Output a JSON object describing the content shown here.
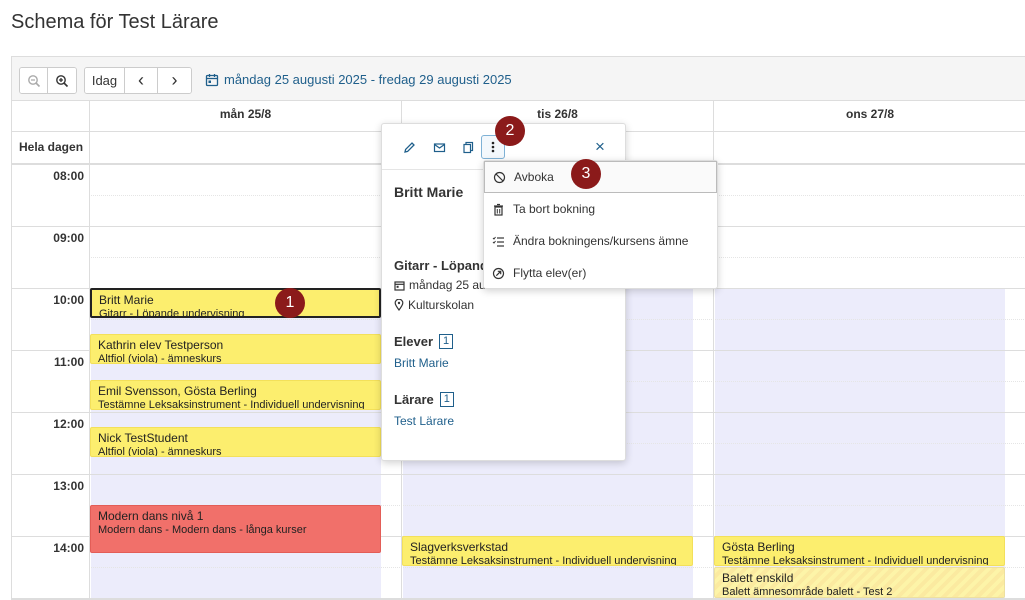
{
  "page": {
    "title": "Schema för Test Lärare"
  },
  "toolbar": {
    "today_label": "Idag",
    "prev_glyph": "‹",
    "next_glyph": "›",
    "date_range": "måndag 25 augusti 2025 - fredag 29 augusti 2025"
  },
  "calendar": {
    "columns": [
      "mån 25/8",
      "tis 26/8",
      "ons 27/8"
    ],
    "allday_label": "Hela dagen",
    "hours": [
      "08:00",
      "09:00",
      "10:00",
      "11:00",
      "12:00",
      "13:00",
      "14:00"
    ]
  },
  "events": [
    {
      "title": "Britt Marie",
      "subtitle": "Gitarr - Löpande undervisning"
    },
    {
      "title": "Kathrin elev Testperson",
      "subtitle": "Altfiol (viola) - ämneskurs"
    },
    {
      "title": "Emil Svensson, Gösta Berling",
      "subtitle": "Testämne Leksaksinstrument - Individuell undervisning"
    },
    {
      "title": "Nick TestStudent",
      "subtitle": "Altfiol (viola) - ämneskurs"
    },
    {
      "title": "Modern dans nivå 1",
      "subtitle": "Modern dans - Modern dans - långa kurser"
    },
    {
      "title": "Slagverksverkstad",
      "subtitle": "Testämne Leksaksinstrument - Individuell undervisning"
    },
    {
      "title": "Gösta Berling",
      "subtitle": "Testämne Leksaksinstrument - Individuell undervisning"
    },
    {
      "title": "Balett enskild",
      "subtitle": "Balett ämnesområde balett - Test 2"
    }
  ],
  "popup": {
    "name": "Britt Marie",
    "course": "Gitarr - Löpande",
    "date": "måndag 25 au",
    "location": "Kulturskolan",
    "students_label": "Elever",
    "students_count": "1",
    "student": "Britt Marie",
    "teachers_label": "Lärare",
    "teachers_count": "1",
    "teacher": "Test Lärare",
    "close_glyph": "×"
  },
  "menu": {
    "items": [
      {
        "label": "Avboka",
        "icon": "cancel-icon"
      },
      {
        "label": "Ta bort bokning",
        "icon": "trash-icon"
      },
      {
        "label": "Ändra bokningens/kursens ämne",
        "icon": "list-check-icon"
      },
      {
        "label": "Flytta elev(er)",
        "icon": "move-icon"
      }
    ]
  },
  "markers": [
    "1",
    "2",
    "3"
  ],
  "colors": {
    "accent": "#1f5f8b",
    "event_yellow": "#fcee6e",
    "event_red": "#f1706a",
    "marker": "#8b1a1a",
    "availability": "#ececfb"
  }
}
